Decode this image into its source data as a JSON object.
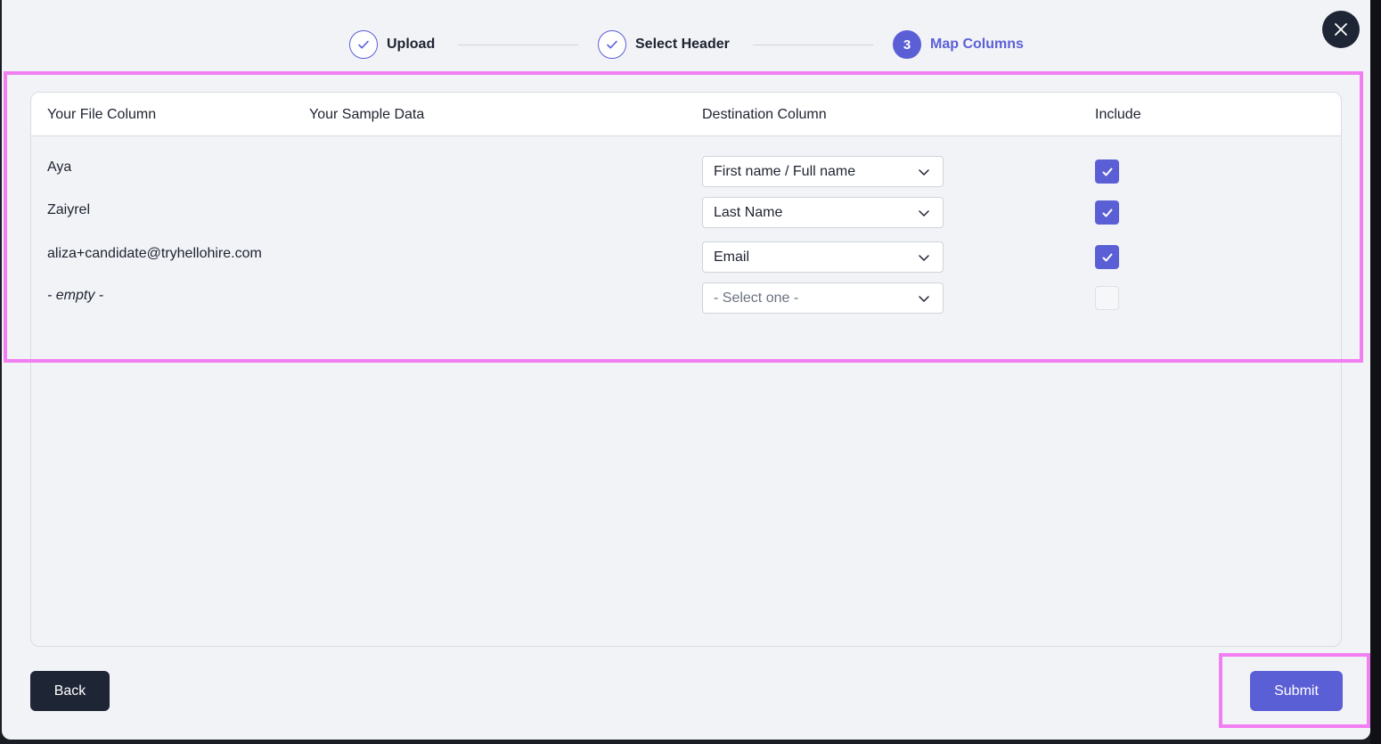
{
  "stepper": {
    "steps": [
      {
        "label": "Upload",
        "state": "done"
      },
      {
        "label": "Select Header",
        "state": "done"
      },
      {
        "label": "Map Columns",
        "state": "active",
        "number": "3"
      }
    ]
  },
  "table": {
    "headers": {
      "file_column": "Your File Column",
      "sample_data": "Your Sample Data",
      "destination": "Destination Column",
      "include": "Include"
    },
    "rows": [
      {
        "file_value": "Aya",
        "destination": "First name / Full name",
        "include": true
      },
      {
        "file_value": "Zaiyrel",
        "destination": "Last Name",
        "include": true
      },
      {
        "file_value": "aliza+candidate@tryhellohire.com",
        "destination": "Email",
        "include": true
      },
      {
        "file_value": "- empty -",
        "destination": "- Select one -",
        "include": false
      }
    ]
  },
  "footer": {
    "back_label": "Back",
    "submit_label": "Submit"
  },
  "colors": {
    "accent": "#5b5fd6",
    "dark": "#1e2535",
    "highlight": "#f27ff2"
  }
}
